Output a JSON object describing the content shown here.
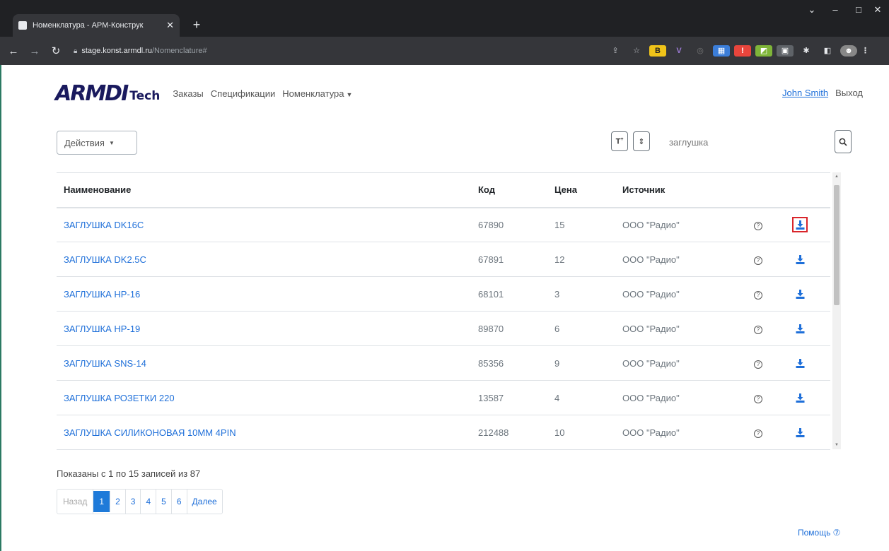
{
  "browser": {
    "tab_title": "Номенклатура - АРМ-Конструк",
    "tab_close": "✕",
    "new_tab": "+",
    "url_host": "stage.konst.armdl.ru",
    "url_path": "/Nomenclature#",
    "minimize": "–",
    "maximize": "□",
    "close": "✕"
  },
  "navbar": {
    "logo_main": "ARMDI",
    "logo_tech": "Tech",
    "links": [
      "Заказы",
      "Спецификации",
      "Номенклатура"
    ],
    "user": "John Smith",
    "logout": "Выход"
  },
  "toolbar": {
    "actions_label": "Действия",
    "search_value": "заглушка"
  },
  "table": {
    "headers": [
      "Наименование",
      "Код",
      "Цена",
      "Источник"
    ],
    "rows": [
      {
        "name": "ЗАГЛУШКА DK16C",
        "code": "67890",
        "price": "15",
        "source": "ООО \"Радио\""
      },
      {
        "name": "ЗАГЛУШКА DK2.5C",
        "code": "67891",
        "price": "12",
        "source": "ООО \"Радио\""
      },
      {
        "name": "ЗАГЛУШКА HP-16",
        "code": "68101",
        "price": "3",
        "source": "ООО \"Радио\""
      },
      {
        "name": "ЗАГЛУШКА HP-19",
        "code": "89870",
        "price": "6",
        "source": "ООО \"Радио\""
      },
      {
        "name": "ЗАГЛУШКА SNS-14",
        "code": "85356",
        "price": "9",
        "source": "ООО \"Радио\""
      },
      {
        "name": "ЗАГЛУШКА РОЗЕТКИ 220",
        "code": "13587",
        "price": "4",
        "source": "ООО \"Радио\""
      },
      {
        "name": "ЗАГЛУШКА СИЛИКОНОВАЯ 10ММ 4PIN",
        "code": "212488",
        "price": "10",
        "source": "ООО \"Радио\""
      }
    ],
    "highlighted_row": 0
  },
  "pagination": {
    "info": "Показаны с 1 по 15 записей из 87",
    "prev": "Назад",
    "pages": [
      "1",
      "2",
      "3",
      "4",
      "5",
      "6"
    ],
    "active_page": "1",
    "next": "Далее"
  },
  "help": "Помощь ⑦",
  "colors": {
    "link": "#1e6fd9",
    "highlight": "#d9252b",
    "active_page": "#1e7ad9"
  }
}
